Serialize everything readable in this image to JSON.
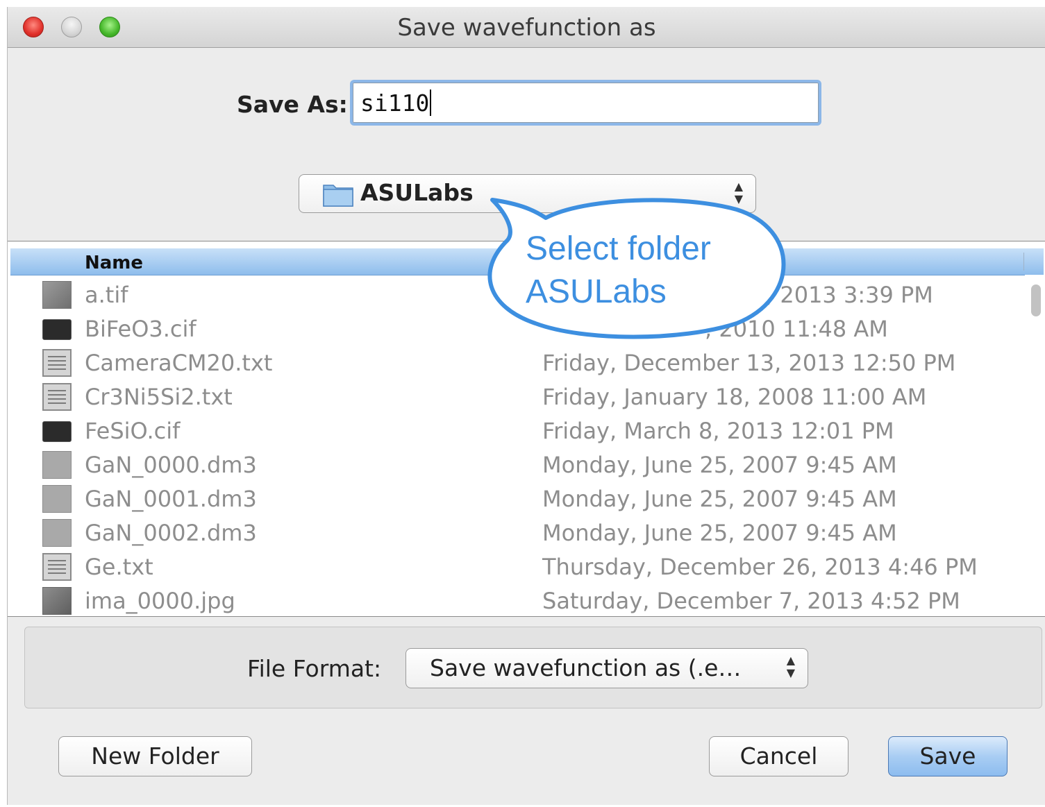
{
  "window": {
    "title": "Save wavefunction as"
  },
  "save_as": {
    "label": "Save As:",
    "value": "si110"
  },
  "folder": {
    "selected": "ASULabs"
  },
  "file_list": {
    "header_name": "Name",
    "rows": [
      {
        "name": "a.tif",
        "date": ", 2013 3:39 PM",
        "icon": "image-file-icon"
      },
      {
        "name": "BiFeO3.cif",
        "date": ", 2010 11:48 AM",
        "icon": "terminal-file-icon"
      },
      {
        "name": "CameraCM20.txt",
        "date": "Friday, December 13, 2013 12:50 PM",
        "icon": "text-file-icon"
      },
      {
        "name": "Cr3Ni5Si2.txt",
        "date": "Friday, January 18, 2008 11:00 AM",
        "icon": "text-file-icon"
      },
      {
        "name": "FeSiO.cif",
        "date": "Friday, March 8, 2013 12:01 PM",
        "icon": "terminal-file-icon"
      },
      {
        "name": "GaN_0000.dm3",
        "date": "Monday, June 25, 2007 9:45 AM",
        "icon": "dm3-file-icon"
      },
      {
        "name": "GaN_0001.dm3",
        "date": "Monday, June 25, 2007 9:45 AM",
        "icon": "dm3-file-icon"
      },
      {
        "name": "GaN_0002.dm3",
        "date": "Monday, June 25, 2007 9:45 AM",
        "icon": "dm3-file-icon"
      },
      {
        "name": "Ge.txt",
        "date": "Thursday, December 26, 2013 4:46 PM",
        "icon": "text-file-icon"
      },
      {
        "name": "ima_0000.jpg",
        "date": "Saturday, December 7, 2013 4:52 PM",
        "icon": "image-file-icon"
      }
    ]
  },
  "callout": {
    "line1": "Select folder",
    "line2": "ASULabs",
    "color": "#3d8fe0"
  },
  "file_format": {
    "label": "File Format:",
    "value": "Save wavefunction as (.e…"
  },
  "buttons": {
    "new_folder": "New Folder",
    "cancel": "Cancel",
    "save": "Save"
  },
  "colors": {
    "header_blue": "#8ebdec",
    "save_button": "#a9cdf3",
    "focus_ring": "#8cb7e8"
  }
}
